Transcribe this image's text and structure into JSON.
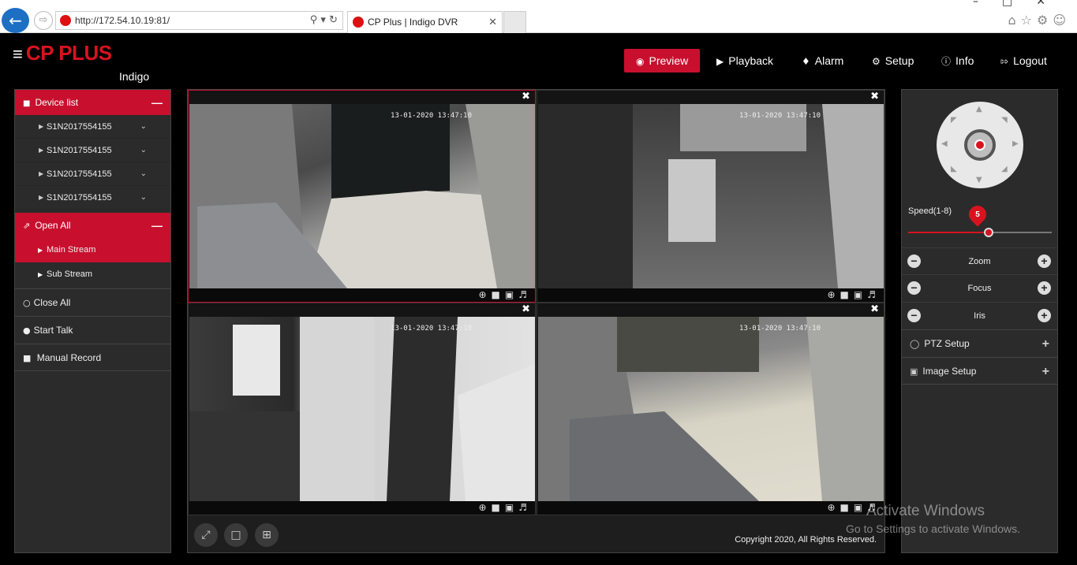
{
  "browser": {
    "url": "http://172.54.10.19:81/",
    "tab_title": "CP Plus | Indigo DVR",
    "back_icon": "arrow-left-icon",
    "forward_icon": "arrow-right-icon"
  },
  "header": {
    "brand": "CP PLUS",
    "subbrand": "Indigo",
    "nav": [
      {
        "label": "Preview",
        "icon": "eye-icon"
      },
      {
        "label": "Playback",
        "icon": "play-circle-icon"
      },
      {
        "label": "Alarm",
        "icon": "bell-icon"
      },
      {
        "label": "Setup",
        "icon": "gear-icon"
      },
      {
        "label": "Info",
        "icon": "info-icon"
      },
      {
        "label": "Logout",
        "icon": "logout-icon"
      }
    ]
  },
  "left_panel": {
    "device_list_label": "Device list",
    "devices": [
      "S1N2017554155",
      "S1N2017554155",
      "S1N2017554155",
      "S1N2017554155"
    ],
    "open_all_label": "Open All",
    "streams": [
      "Main Stream",
      "Sub Stream"
    ],
    "close_all_label": "Close All",
    "start_talk_label": "Start Talk",
    "manual_record_label": "Manual Record"
  },
  "video": {
    "channels": [
      {
        "timestamp": "13-01-2020 13:47:10"
      },
      {
        "timestamp": "13-01-2020 13:47:10"
      },
      {
        "timestamp": "13-01-2020 13:47:10"
      },
      {
        "timestamp": "13-01-2020 13:47:10"
      }
    ],
    "copyright": "Copyright 2020, All Rights Reserved."
  },
  "right_panel": {
    "speed_label": "Speed(1-8)",
    "speed_value": "5",
    "speed_fraction": 0.5625,
    "zoom_label": "Zoom",
    "focus_label": "Focus",
    "iris_label": "Iris",
    "ptz_setup_label": "PTZ Setup",
    "image_setup_label": "Image Setup"
  },
  "watermark": {
    "line1": "Activate Windows",
    "line2": "Go to Settings to activate Windows."
  },
  "colors": {
    "accent": "#c8102e",
    "panel": "#2b2b2b",
    "background": "#000000"
  }
}
